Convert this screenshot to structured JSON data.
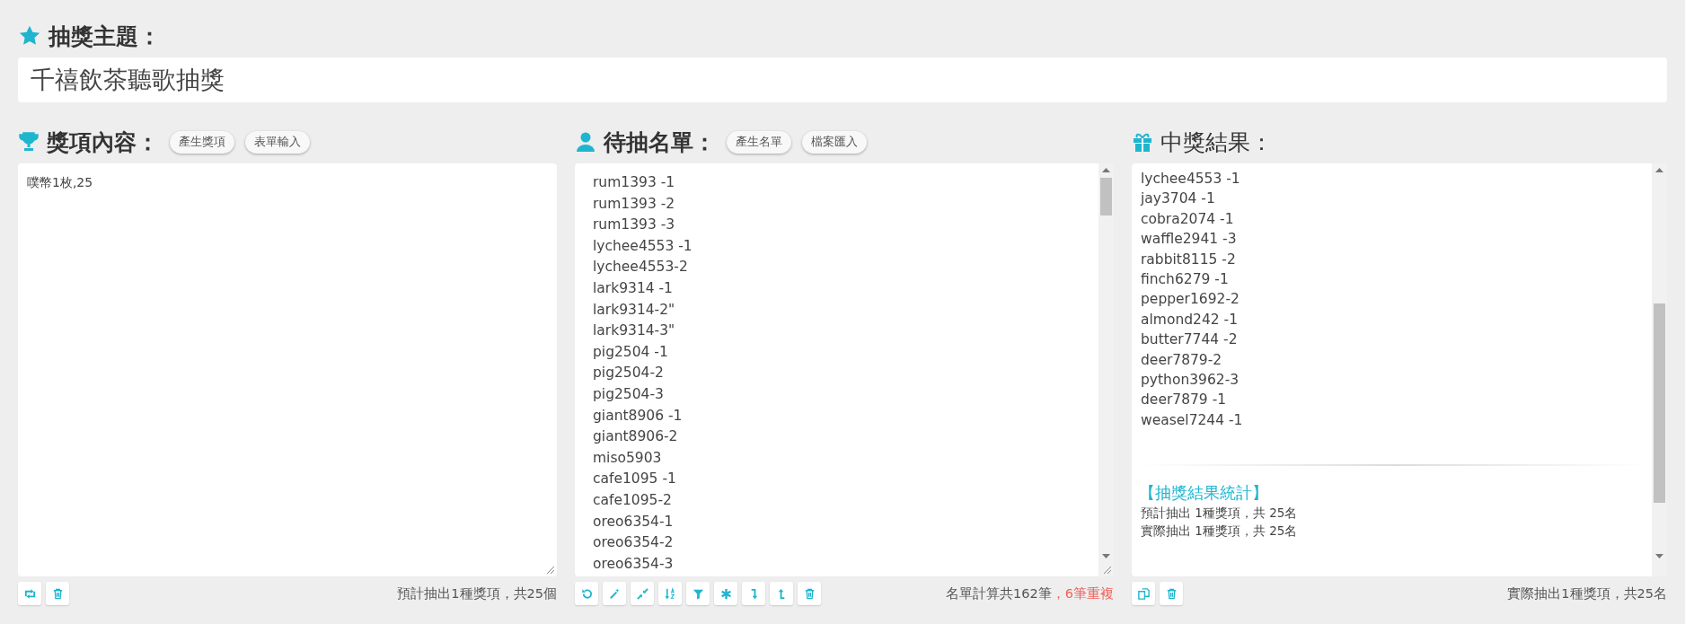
{
  "topic": {
    "label": "抽獎主題：",
    "value": "千禧飲茶聽歌抽獎"
  },
  "prizes": {
    "heading": "獎項內容：",
    "buttons": [
      "產生獎項",
      "表單輸入"
    ],
    "lines": [
      "噗幣1枚,25"
    ],
    "footer": "預計抽出1種獎項，共25個"
  },
  "candidates": {
    "heading": "待抽名單：",
    "buttons": [
      "產生名單",
      "檔案匯入"
    ],
    "lines": [
      "rum1393 -1",
      "rum1393 -2",
      "rum1393 -3",
      "lychee4553 -1",
      "lychee4553-2",
      "lark9314 -1",
      "lark9314-2\"",
      "lark9314-3\"",
      "pig2504 -1",
      "pig2504-2",
      "pig2504-3",
      "giant8906 -1",
      "giant8906-2",
      "miso5903",
      "cafe1095 -1",
      "cafe1095-2",
      "oreo6354-1",
      "oreo6354-2",
      "oreo6354-3"
    ],
    "footer": "名單計算共162筆",
    "duplicates": "，6筆重複"
  },
  "results": {
    "heading": "中獎結果：",
    "lines": [
      "lychee4553 -1",
      "jay3704 -1",
      "cobra2074 -1",
      "waffle2941 -3",
      "rabbit8115 -2",
      "finch6279 -1",
      "pepper1692-2",
      "almond242 -1",
      "butter7744 -2",
      "deer7879-2",
      "python3962-3",
      "deer7879 -1",
      "weasel7244 -1"
    ],
    "summary_title": "【抽獎結果統計】",
    "summary_lines": [
      "預計抽出 1種獎項，共 25名",
      "實際抽出 1種獎項，共 25名"
    ],
    "footer": "實際抽出1種獎項，共25名"
  }
}
